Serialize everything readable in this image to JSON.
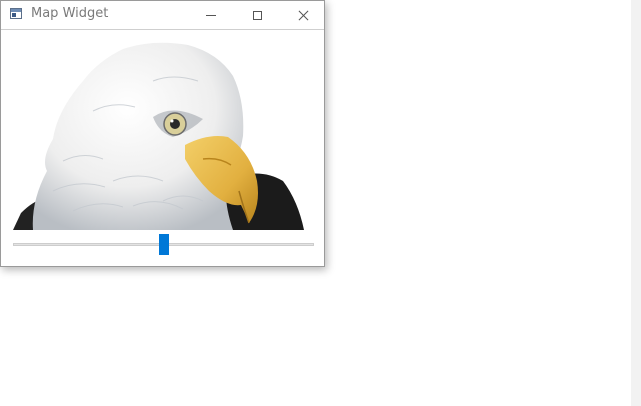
{
  "window": {
    "title": "Map Widget",
    "app_icon": "window-app-icon",
    "controls": {
      "minimize_icon": "minimize-icon",
      "maximize_icon": "maximize-icon",
      "close_icon": "close-icon"
    }
  },
  "image": {
    "subject": "bald-eagle-head",
    "colors": {
      "feather_white": "#f2f2f2",
      "feather_shadow": "#c9cdd2",
      "beak_yellow": "#e8b94a",
      "beak_dark": "#c98f1f",
      "eye": "#d9cf9a",
      "body_dark": "#1b1b1b"
    }
  },
  "slider": {
    "value": 0.5,
    "thumb_color": "#0078d7",
    "track_color": "#e3e3e3"
  }
}
